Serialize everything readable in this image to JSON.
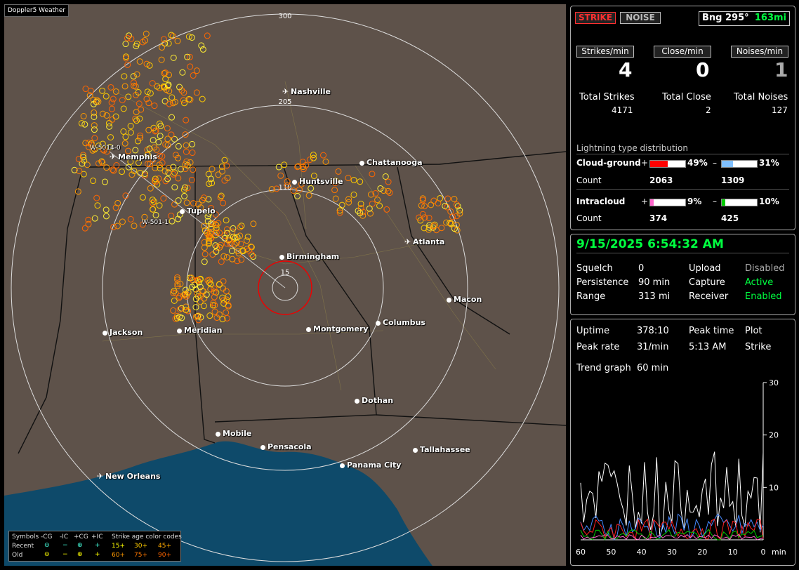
{
  "map": {
    "title": "Doppler5 Weather",
    "ring_labels": {
      "r300": "300",
      "r205": "205",
      "r110": "110",
      "r15": "15"
    },
    "cities": [
      {
        "name": "Nashville",
        "airport": true
      },
      {
        "name": "Memphis",
        "airport": true
      },
      {
        "name": "Chattanooga",
        "airport": false
      },
      {
        "name": "Huntsville",
        "airport": false
      },
      {
        "name": "Tupelo",
        "airport": false
      },
      {
        "name": "Atlanta",
        "airport": true
      },
      {
        "name": "Birmingham",
        "airport": false
      },
      {
        "name": "Macon",
        "airport": false
      },
      {
        "name": "Jackson",
        "airport": false
      },
      {
        "name": "Meridian",
        "airport": false
      },
      {
        "name": "Montgomery",
        "airport": false
      },
      {
        "name": "Columbus",
        "airport": false
      },
      {
        "name": "Dothan",
        "airport": false
      },
      {
        "name": "Mobile",
        "airport": false
      },
      {
        "name": "Pensacola",
        "airport": false
      },
      {
        "name": "Tallahassee",
        "airport": false
      },
      {
        "name": "Panama City",
        "airport": false
      },
      {
        "name": "New Orleans",
        "airport": true
      }
    ],
    "annotations": [
      "W-5014-0",
      "W-501-1"
    ],
    "legend": {
      "row_header": "Symbols",
      "cols": [
        "-CG",
        "-IC",
        "+CG",
        "+IC"
      ],
      "age_header": "Strike age color codes",
      "recent": "Recent",
      "old": "Old",
      "recent_ages": [
        "15+",
        "30+",
        "45+"
      ],
      "old_ages": [
        "60+",
        "75+",
        "90+"
      ]
    }
  },
  "status": {
    "strike_label": "STRIKE",
    "noise_label": "NOISE",
    "bearing": "Bng 295°",
    "distance": "163mi"
  },
  "rates": {
    "strikes_min_label": "Strikes/min",
    "close_min_label": "Close/min",
    "noises_min_label": "Noises/min",
    "strikes_min": "4",
    "close_min": "0",
    "noises_min": "1",
    "total_strikes_label": "Total Strikes",
    "total_close_label": "Total Close",
    "total_noises_label": "Total Noises",
    "total_strikes": "4171",
    "total_close": "2",
    "total_noises": "127"
  },
  "distribution": {
    "title": "Lightning type distribution",
    "cg_label": "Cloud-ground",
    "ic_label": "Intracloud",
    "count_label": "Count",
    "plus": "+",
    "minus": "–",
    "cg_pos_pct": "49%",
    "cg_neg_pct": "31%",
    "cg_pos_count": "2063",
    "cg_neg_count": "1309",
    "ic_pos_pct": "9%",
    "ic_neg_pct": "10%",
    "ic_pos_count": "374",
    "ic_neg_count": "425",
    "cg_pos_frac": 0.49,
    "cg_neg_frac": 0.31,
    "ic_pos_frac": 0.09,
    "ic_neg_frac": 0.1,
    "colors": {
      "cg_pos": "#ff0000",
      "cg_neg": "#80c0ff",
      "ic_pos": "#ff66cc",
      "ic_neg": "#00cc00"
    }
  },
  "system": {
    "datetime": "9/15/2025 6:54:32 AM",
    "squelch_label": "Squelch",
    "squelch": "0",
    "upload_label": "Upload",
    "upload": "Disabled",
    "persistence_label": "Persistence",
    "persistence": "90 min",
    "capture_label": "Capture",
    "capture": "Active",
    "range_label": "Range",
    "range": "313 mi",
    "receiver_label": "Receiver",
    "receiver": "Enabled"
  },
  "trend": {
    "uptime_label": "Uptime",
    "uptime": "378:10",
    "peak_time_label": "Peak time",
    "peak_time": "5:13 AM",
    "plot_label": "Plot",
    "peak_rate_label": "Peak rate",
    "peak_rate": "31/min",
    "plot": "Strike",
    "graph_label": "Trend graph",
    "graph_window": "60 min",
    "y_ticks": [
      "30",
      "20",
      "10"
    ],
    "x_ticks": [
      "60",
      "50",
      "40",
      "30",
      "20",
      "10",
      "0"
    ],
    "x_unit": "min"
  }
}
